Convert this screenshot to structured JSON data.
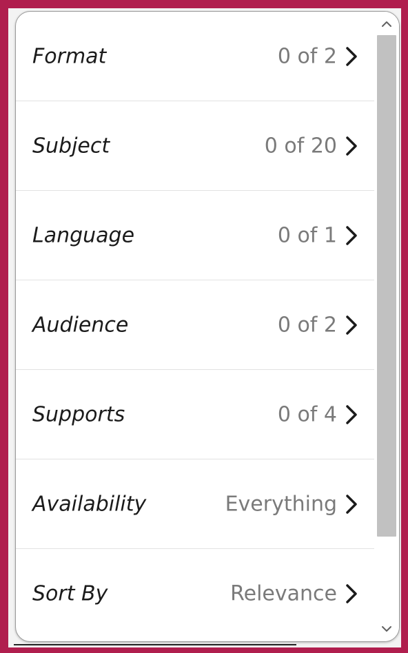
{
  "filters": {
    "items": [
      {
        "label": "Format",
        "value": "0 of 2"
      },
      {
        "label": "Subject",
        "value": "0 of 20"
      },
      {
        "label": "Language",
        "value": "0 of 1"
      },
      {
        "label": "Audience",
        "value": "0 of 2"
      },
      {
        "label": "Supports",
        "value": "0 of 4"
      },
      {
        "label": "Availability",
        "value": "Everything"
      },
      {
        "label": "Sort By",
        "value": "Relevance"
      }
    ],
    "chevron_icon": "chevron-right-icon"
  },
  "scrollbar": {
    "up_icon": "chevron-up-icon",
    "down_icon": "chevron-down-icon",
    "thumb_fraction": 0.86
  },
  "colors": {
    "frame_accent": "#b01e4e",
    "label_text": "#1b1b1b",
    "value_text": "#7a7a7a",
    "divider": "#e2e2e2",
    "scroll_thumb": "#c1c1c1"
  }
}
